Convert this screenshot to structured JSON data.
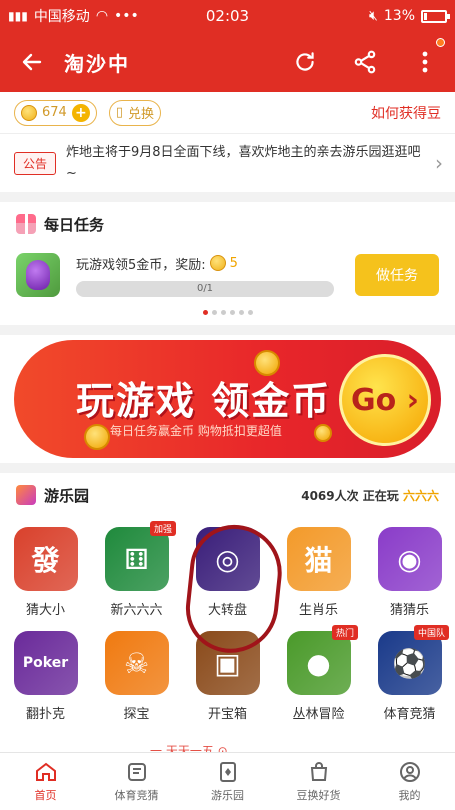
{
  "status": {
    "carrier": "中国移动",
    "time": "02:03",
    "battery": "13%",
    "battery_level": 0.13
  },
  "header": {
    "title": "淘沙中"
  },
  "coins": {
    "balance": "674",
    "exchange_label": "兑换",
    "how_label": "如何获得豆"
  },
  "notice": {
    "tag": "公告",
    "text": "炸地主将于9月8日全面下线，喜欢炸地主的亲去游乐园逛逛吧~"
  },
  "daily": {
    "title": "每日任务",
    "task_text": "玩游戏领5金币，奖励:",
    "reward": "5",
    "progress": "0/1",
    "progress_value": 0,
    "button": "做任务",
    "carousel_pages": 6,
    "carousel_active": 0
  },
  "banner": {
    "headline": "玩游戏 领金币",
    "sub": "每日任务赢金币   购物抵扣更超值",
    "go": "Go ›"
  },
  "playground": {
    "title": "游乐园",
    "online_count": "4069人次 正在玩",
    "online_suffix": "六六六",
    "games": [
      {
        "name": "猜大小",
        "icon": "fa-tile-icon",
        "color": "#d9412c"
      },
      {
        "name": "新六六六",
        "icon": "dice-icon",
        "color": "#1f8a3c",
        "badge": "加强"
      },
      {
        "name": "大转盘",
        "icon": "wheel-icon",
        "color": "#3a1e7a"
      },
      {
        "name": "生肖乐",
        "icon": "lucky-cat-icon",
        "color": "#f39a2a"
      },
      {
        "name": "猜猜乐",
        "icon": "eye-icon",
        "color": "#8a3cc9"
      },
      {
        "name": "翻扑克",
        "icon": "poker-icon",
        "color": "#6a2a9a"
      },
      {
        "name": "探宝",
        "icon": "skull-icon",
        "color": "#f07a10"
      },
      {
        "name": "开宝箱",
        "icon": "treasure-chest-icon",
        "color": "#8a4a1a"
      },
      {
        "name": "丛林冒险",
        "icon": "bug-icon",
        "color": "#4a9a2a",
        "badge": "热门"
      },
      {
        "name": "体育竞猜",
        "icon": "sports-shoe-icon",
        "color": "#1a3a8a",
        "badge": "中国队"
      }
    ]
  },
  "ribbon": "一 天天一五 ⊙",
  "nav": [
    {
      "label": "首页",
      "icon": "home-icon",
      "active": true
    },
    {
      "label": "体育竞猜",
      "icon": "ticket-icon",
      "active": false
    },
    {
      "label": "游乐园",
      "icon": "cards-icon",
      "active": false
    },
    {
      "label": "豆换好货",
      "icon": "bag-icon",
      "active": false
    },
    {
      "label": "我的",
      "icon": "user-icon",
      "active": false
    }
  ]
}
